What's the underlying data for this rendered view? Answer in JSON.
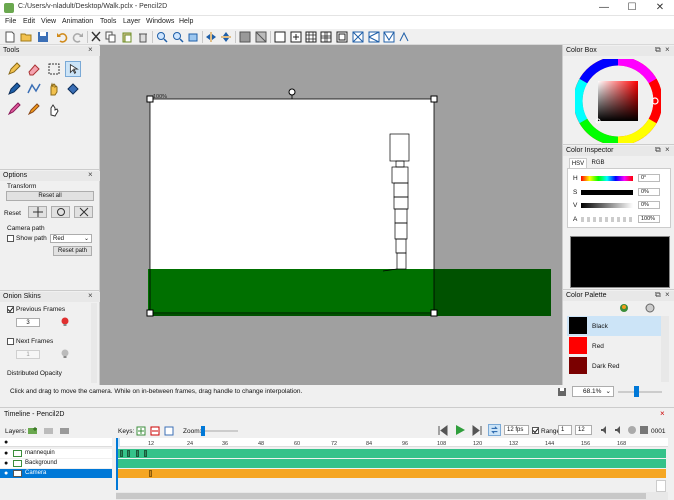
{
  "window": {
    "title": "C:/Users/v-nladult/Desktop/Walk.pclx - Pencil2D",
    "minimize_glyph": "—",
    "maximize_glyph": "☐",
    "close_glyph": "✕"
  },
  "menu": [
    "File",
    "Edit",
    "View",
    "Animation",
    "Tools",
    "Layer",
    "Windows",
    "Help"
  ],
  "toolbar_icons": [
    "new-icon",
    "open-icon",
    "save-icon",
    "undo-icon",
    "redo-icon",
    "cut-icon",
    "copy-icon",
    "paste-icon",
    "delete-icon",
    "zoom-in-icon",
    "zoom-out-icon",
    "rotate-left-icon",
    "rotate-right-icon",
    "flip-horizontal-icon",
    "flip-vertical-icon",
    "onion-skin-icon",
    "grid-icon",
    "overlay-center-icon",
    "overlay-thirds-icon",
    "overlay-golden-icon",
    "overlay-safe-icon",
    "overlay-camera-icon",
    "overlay-perspective-1-icon",
    "overlay-perspective-2-icon",
    "overlay-perspective-3-icon"
  ],
  "tools_panel": {
    "title": "Tools",
    "tools": [
      "pencil-icon",
      "eraser-icon",
      "select-icon",
      "move-icon",
      "pen-icon",
      "polyline-icon",
      "hand-icon",
      "bucket-icon",
      "brush-icon",
      "eyedropper-icon",
      "smudge-icon"
    ]
  },
  "options_panel": {
    "title": "Options",
    "transform_label": "Transform",
    "reset_all_label": "Reset all",
    "reset_label": "Reset",
    "camera_path_label": "Camera path",
    "show_path_label": "Show path",
    "path_color": "Red",
    "reset_path_label": "Reset path"
  },
  "onion_panel": {
    "title": "Onion Skins",
    "previous_frames_label": "Previous Frames",
    "previous_count": "3",
    "next_frames_label": "Next Frames",
    "next_count": "1",
    "distributed_opacity_label": "Distributed Opacity"
  },
  "canvas": {
    "opacity_label": "100%"
  },
  "status": {
    "hint": "Click and drag to move the camera. While on in-between frames, drag handle to change interpolation.",
    "zoom_value": "68.1%"
  },
  "color_box": {
    "title": "Color Box"
  },
  "color_inspector": {
    "title": "Color Inspector",
    "tabs": [
      "HSV",
      "RGB"
    ],
    "h_label": "H",
    "h_value": "0°",
    "s_label": "S",
    "s_value": "0%",
    "v_label": "V",
    "v_value": "0%",
    "a_label": "A",
    "a_value": "100%",
    "current_color": "#000000"
  },
  "color_palette": {
    "title": "Color Palette",
    "items": [
      {
        "name": "Black",
        "color": "#000000"
      },
      {
        "name": "Red",
        "color": "#ff0000"
      },
      {
        "name": "Dark Red",
        "color": "#7a0000"
      }
    ]
  },
  "timeline": {
    "title": "Timeline - Pencil2D",
    "layers_label": "Layers:",
    "keys_label": "Keys:",
    "zoom_label": "Zoom:",
    "fps_value": "12 fps",
    "range_label": "Range",
    "range_start": "1",
    "range_end": "12",
    "frame_counter": "0001",
    "ruler": [
      "12",
      "24",
      "36",
      "48",
      "60",
      "72",
      "84",
      "96",
      "108",
      "120",
      "132",
      "144",
      "156",
      "168"
    ],
    "layers": [
      {
        "name": "mannequin",
        "type": "vector",
        "color": "#35c28a"
      },
      {
        "name": "Background",
        "type": "bitmap",
        "color": "#35c28a"
      },
      {
        "name": "Camera",
        "type": "camera",
        "color": "#f5a623",
        "selected": true
      }
    ]
  },
  "colors": {
    "ground": "#007000",
    "ground_shadow": "#005200",
    "canvas_bg": "#a0a0a0",
    "selection": "#0078d7"
  }
}
